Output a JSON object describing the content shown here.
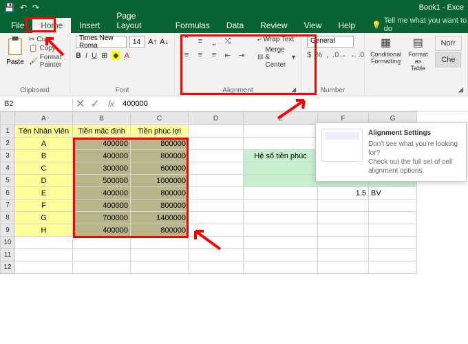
{
  "title": "Book1 - Exce",
  "tabs": [
    "File",
    "Home",
    "Insert",
    "Page Layout",
    "Formulas",
    "Data",
    "Review",
    "View",
    "Help"
  ],
  "tell_me": "Tell me what you want to do",
  "clipboard": {
    "paste": "Paste",
    "cut": "Cut",
    "copy": "Copy",
    "format_painter": "Format Painter",
    "label": "Clipboard"
  },
  "font": {
    "name": "Times New Roma",
    "size": "14",
    "label": "Font"
  },
  "alignment": {
    "wrap": "Wrap Text",
    "merge": "Merge & Center",
    "label": "Alignment"
  },
  "number": {
    "format": "General",
    "label": "Number"
  },
  "styles": {
    "cond": "Conditional Formatting",
    "table": "Format as Table",
    "norm": "Norr",
    "chk": "Che"
  },
  "namebox": "B2",
  "formula": "400000",
  "columns": [
    "A",
    "B",
    "C",
    "D",
    "E",
    "F",
    "G"
  ],
  "headers": {
    "A": "Tên Nhân Viên",
    "B": "Tiền mặc định",
    "C": "Tiền phúc lợi"
  },
  "rows": [
    {
      "A": "A",
      "B": "400000",
      "C": "800000"
    },
    {
      "A": "B",
      "B": "400000",
      "C": "800000"
    },
    {
      "A": "C",
      "B": "300000",
      "C": "600000"
    },
    {
      "A": "D",
      "B": "500000",
      "C": "1000000"
    },
    {
      "A": "E",
      "B": "400000",
      "C": "800000"
    },
    {
      "A": "F",
      "B": "400000",
      "C": "800000"
    },
    {
      "A": "G",
      "B": "700000",
      "C": "1400000"
    },
    {
      "A": "H",
      "B": "400000",
      "C": "800000"
    }
  ],
  "side": {
    "E3": "Hệ số tiền phúc",
    "F6": "1.5",
    "G6": "BV"
  },
  "tooltip": {
    "title": "Alignment Settings",
    "l1": "Don't see what you're looking for?",
    "l2": "Check out the full set of cell alignment options."
  }
}
